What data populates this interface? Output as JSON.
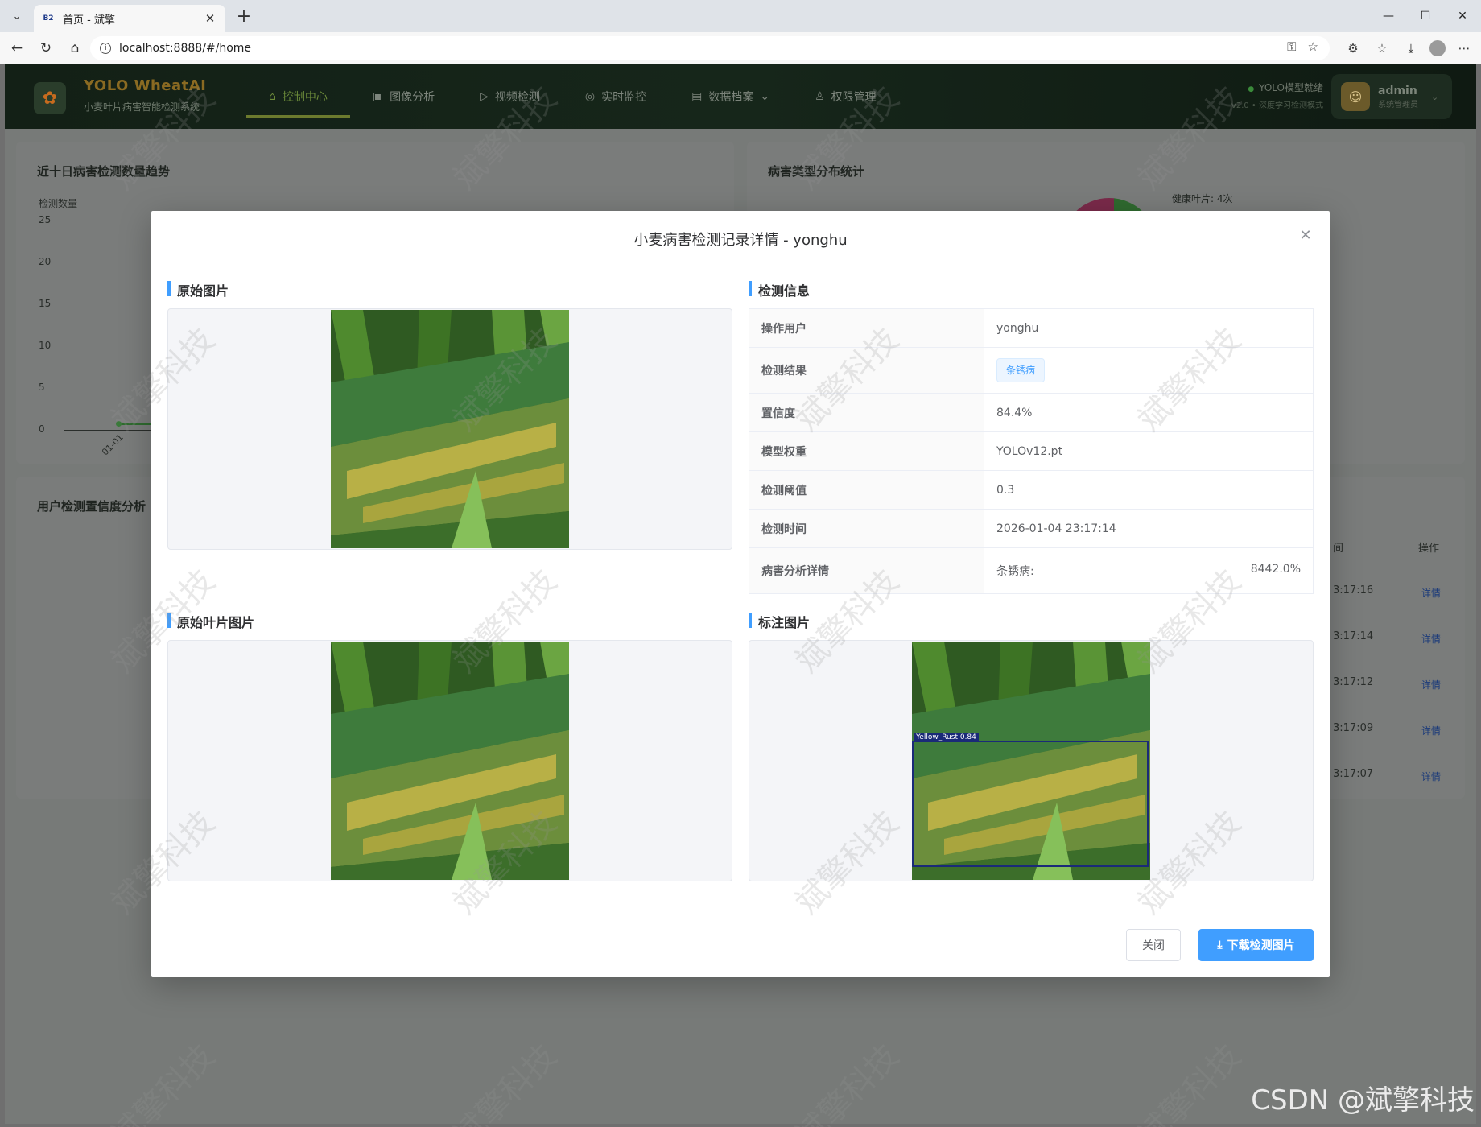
{
  "browser": {
    "tab_title": "首页 - 斌擎",
    "favicon_text": "B2",
    "url": "localhost:8888/#/home"
  },
  "app": {
    "brand_title": "YOLO WheatAI",
    "brand_subtitle": "小麦叶片病害智能检测系统",
    "nav": [
      {
        "label": "控制中心",
        "icon": "home-icon"
      },
      {
        "label": "图像分析",
        "icon": "image-icon"
      },
      {
        "label": "视频检测",
        "icon": "play-icon"
      },
      {
        "label": "实时监控",
        "icon": "camera-icon"
      },
      {
        "label": "数据档案",
        "icon": "document-icon"
      },
      {
        "label": "权限管理",
        "icon": "user-icon"
      }
    ],
    "model_status": "YOLO模型就绪",
    "model_version": "v2.0 • 深度学习检测模式",
    "user": {
      "name": "admin",
      "role": "系统管理员"
    }
  },
  "dashboard": {
    "trend_title": "近十日病害检测数量趋势",
    "trend_ylabel": "检测数量",
    "trend_yticks": [
      "25",
      "20",
      "15",
      "10",
      "5",
      "0"
    ],
    "trend_xtick": "01-01",
    "pie_title": "病害类型分布统计",
    "pie_label": "健康叶片: 4次",
    "confidence_title": "用户检测置信度分析",
    "table_headers": {
      "time": "间",
      "action": "操作"
    },
    "rows": [
      {
        "time": "3:17:16",
        "action": "详情"
      },
      {
        "time": "3:17:14",
        "action": "详情"
      },
      {
        "time": "3:17:12",
        "action": "详情"
      },
      {
        "time": "3:17:09",
        "action": "详情"
      },
      {
        "time": "3:17:07",
        "action": "详情"
      }
    ]
  },
  "modal": {
    "title": "小麦病害检测记录详情 - yonghu",
    "sections": {
      "original_image": "原始图片",
      "detection_info": "检测信息",
      "leaf_image": "原始叶片图片",
      "annotated_image": "标注图片"
    },
    "info": {
      "user_label": "操作用户",
      "user": "yonghu",
      "result_label": "检测结果",
      "result": "条锈病",
      "confidence_label": "置信度",
      "confidence": "84.4%",
      "weights_label": "模型权重",
      "weights": "YOLOv12.pt",
      "threshold_label": "检测阈值",
      "threshold": "0.3",
      "time_label": "检测时间",
      "time": "2026-01-04 23:17:14",
      "analysis_label": "病害分析详情",
      "analysis_name": "条锈病:",
      "analysis_value": "8442.0%"
    },
    "detection_box_label": "Yellow_Rust 0.84",
    "close_button": "关闭",
    "download_button": "下载检测图片"
  },
  "watermark": "斌擎科技",
  "csdn_watermark": "CSDN @斌擎科技"
}
